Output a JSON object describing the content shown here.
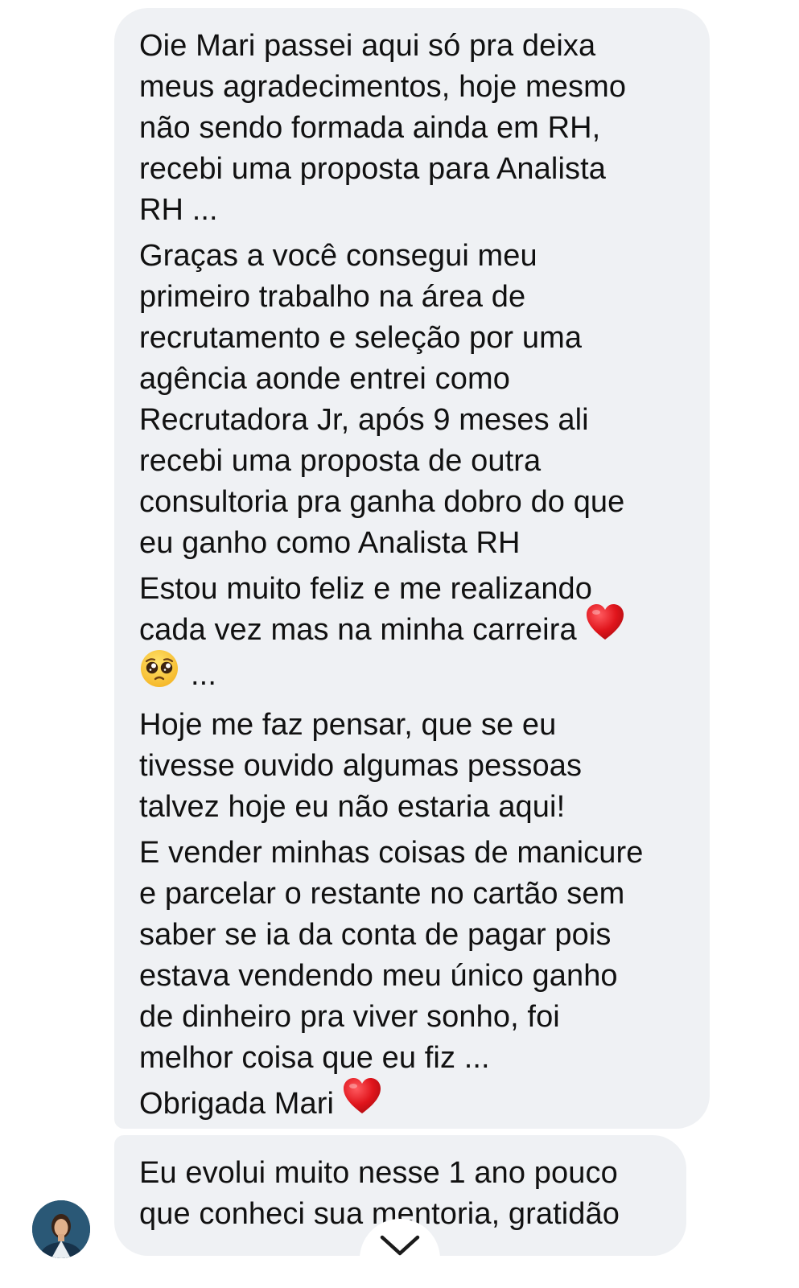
{
  "message_1": {
    "paragraphs": [
      "Oie Mari passei aqui só pra deixa\nmeus agradecimentos, hoje mesmo\nnão sendo formada ainda em RH,\nrecebi uma proposta para Analista\nRH ...",
      "Graças a você consegui meu\nprimeiro trabalho na área de\nrecrutamento e seleção por uma\nagência aonde entrei como\nRecrutadora Jr, após 9 meses ali\nrecebi uma proposta de outra\nconsultoria pra ganha dobro do que\neu ganho como Analista RH",
      "Estou muito feliz e me realizando\ncada vez mas na minha carreira",
      "...",
      "Hoje me faz pensar, que se eu\ntivesse ouvido algumas pessoas\ntalvez hoje eu não estaria aqui!",
      "E vender minhas coisas de manicure\ne parcelar o restante no cartão sem\nsaber se ia da conta de pagar pois\nestava vendendo meu único ganho\nde dinheiro pra viver sonho, foi\nmelhor coisa que eu fiz ...",
      "Obrigada Mari"
    ],
    "emoji_heart": "heart-emoji",
    "emoji_pleading": "pleading-face-emoji"
  },
  "message_2": {
    "text": "Eu evolui muito nesse 1 ano pouco\nque conheci sua mentoria, gratidão"
  },
  "icons": {
    "avatar": "avatar",
    "scroll_down": "chevron-down-icon"
  },
  "colors": {
    "bubble": "#eff1f4",
    "heart": "#e0151c",
    "avatar_bg": "#1f4560"
  }
}
